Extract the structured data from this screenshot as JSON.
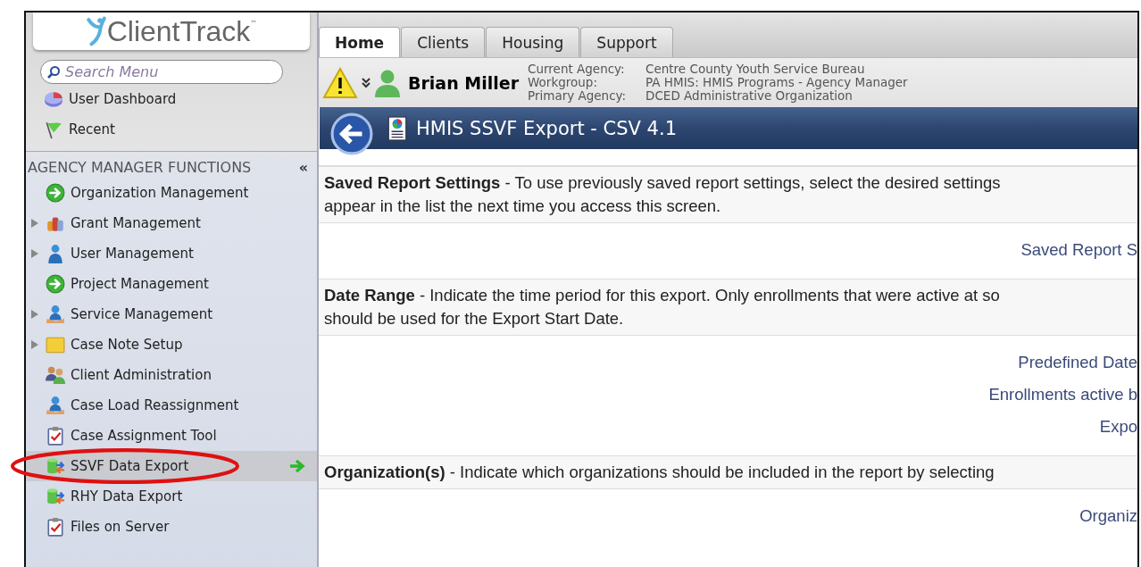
{
  "logo": {
    "text": "ClientTrack",
    "mark": "™"
  },
  "tabs": [
    {
      "label": "Home",
      "selected": true
    },
    {
      "label": "Clients",
      "selected": false
    },
    {
      "label": "Housing",
      "selected": false
    },
    {
      "label": "Support",
      "selected": false
    }
  ],
  "search": {
    "placeholder": "Search Menu"
  },
  "quick_links": [
    {
      "label": "User Dashboard",
      "kind": "chart"
    },
    {
      "label": "Recent",
      "kind": "flag"
    }
  ],
  "user": {
    "name": "Brian Miller",
    "warning": true,
    "details": [
      {
        "label": "Current Agency:",
        "value": "Centre County Youth Service Bureau"
      },
      {
        "label": "Workgroup:",
        "value": "PA HMIS: HMIS Programs - Agency Manager"
      },
      {
        "label": "Primary Agency:",
        "value": "DCED Administrative Organization"
      }
    ]
  },
  "sidebar": {
    "title": "AGENCY MANAGER FUNCTIONS",
    "collapse": "«",
    "items": [
      {
        "label": "Organization Management",
        "kind": "go",
        "expandable": false,
        "selected": false,
        "circled": false
      },
      {
        "label": "Grant Management",
        "kind": "coins",
        "expandable": true,
        "selected": false,
        "circled": false
      },
      {
        "label": "User Management",
        "kind": "user",
        "expandable": true,
        "selected": false,
        "circled": false
      },
      {
        "label": "Project Management",
        "kind": "go",
        "expandable": false,
        "selected": false,
        "circled": false
      },
      {
        "label": "Service Management",
        "kind": "service",
        "expandable": true,
        "selected": false,
        "circled": false
      },
      {
        "label": "Case Note Setup",
        "kind": "note",
        "expandable": true,
        "selected": false,
        "circled": false
      },
      {
        "label": "Client Administration",
        "kind": "people",
        "expandable": false,
        "selected": false,
        "circled": false
      },
      {
        "label": "Case Load Reassignment",
        "kind": "service",
        "expandable": false,
        "selected": false,
        "circled": false
      },
      {
        "label": "Case Assignment Tool",
        "kind": "clipboard",
        "expandable": false,
        "selected": false,
        "circled": false
      },
      {
        "label": "SSVF Data Export",
        "kind": "database",
        "expandable": false,
        "selected": true,
        "circled": true
      },
      {
        "label": "RHY Data Export",
        "kind": "database",
        "expandable": false,
        "selected": false,
        "circled": false
      },
      {
        "label": "Files on Server",
        "kind": "clipboard",
        "expandable": false,
        "selected": false,
        "circled": false
      }
    ]
  },
  "page_title": "HMIS SSVF Export - CSV 4.1",
  "sections": [
    {
      "lines": [
        "**Saved Report Settings** - To use previously saved report settings, select the desired settings",
        "appear in the list the next time you access this screen."
      ],
      "fields": [
        "Saved Report S"
      ]
    },
    {
      "lines": [
        "**Date Range** - Indicate the time period for this export. Only enrollments that were active at so",
        "should be used for the Export Start Date."
      ],
      "fields": [
        "Predefined Date",
        "Enrollments active b",
        "Expo"
      ]
    },
    {
      "lines": [
        "**Organization(s)** - Indicate which organizations should be included in the report by selecting"
      ],
      "fields": [
        "Organiz"
      ]
    }
  ]
}
